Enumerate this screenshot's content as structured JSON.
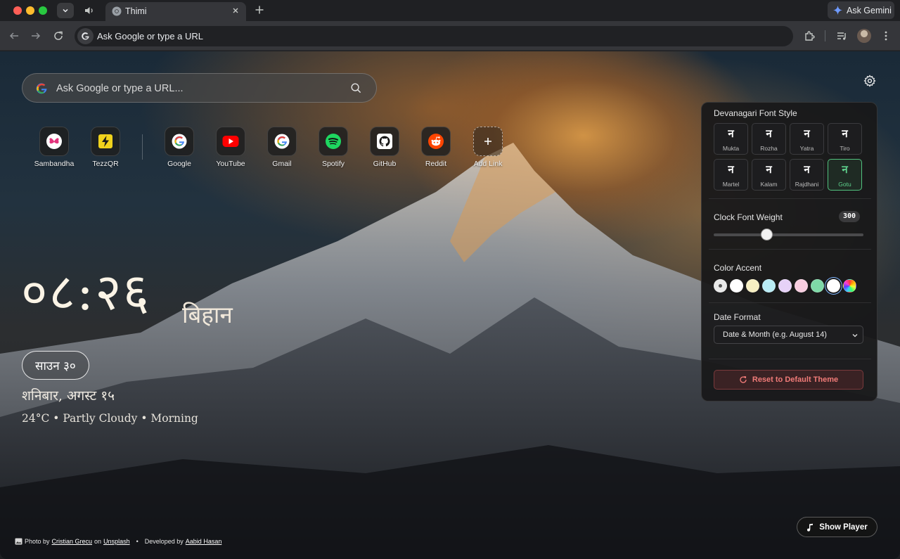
{
  "browser": {
    "tab_title": "Thimi",
    "ask_gemini": "Ask Gemini",
    "omnibox_placeholder": "Ask Google or type a URL"
  },
  "ntp": {
    "search_placeholder": "Ask Google or type a URL...",
    "shortcuts": [
      {
        "label": "Sambandha",
        "icon": "butterfly-icon"
      },
      {
        "label": "TezzQR",
        "icon": "lightning-icon"
      },
      {
        "label": "Google",
        "icon": "google-icon"
      },
      {
        "label": "YouTube",
        "icon": "youtube-icon"
      },
      {
        "label": "Gmail",
        "icon": "gmail-icon"
      },
      {
        "label": "Spotify",
        "icon": "spotify-icon"
      },
      {
        "label": "GitHub",
        "icon": "github-icon"
      },
      {
        "label": "Reddit",
        "icon": "reddit-icon"
      },
      {
        "label": "Add Link",
        "icon": "plus-icon"
      }
    ]
  },
  "clock": {
    "time": "०८:२६",
    "period": "बिहान",
    "nepali_date": "साउन ३०",
    "date_line": "शनिबार, अगस्ट १५",
    "weather": "24°C • Partly Cloudy • Morning"
  },
  "settings": {
    "font_style_heading": "Devanagari Font Style",
    "font_glyph": "न",
    "fonts": [
      {
        "name": "Mukta",
        "active": false
      },
      {
        "name": "Rozha",
        "active": false
      },
      {
        "name": "Yatra",
        "active": false
      },
      {
        "name": "Tiro",
        "active": false
      },
      {
        "name": "Martel",
        "active": false
      },
      {
        "name": "Kalam",
        "active": false
      },
      {
        "name": "Rajdhani",
        "active": false
      },
      {
        "name": "Gotu",
        "active": true
      }
    ],
    "clock_weight_heading": "Clock Font Weight",
    "clock_weight_value": "300",
    "clock_weight_min": 100,
    "clock_weight_max": 900,
    "color_accent_heading": "Color Accent",
    "accent_colors": [
      "#e9e9e9",
      "#ffffff",
      "#f7efc2",
      "#b9ecf5",
      "#e6d2f7",
      "#f8cde0",
      "#7ed9a7",
      "#ffffff"
    ],
    "accent_selected_index": 7,
    "date_format_heading": "Date Format",
    "date_format_value": "Date & Month (e.g. August 14)",
    "reset_label": "Reset to Default Theme"
  },
  "player": {
    "show_label": "Show Player"
  },
  "credits": {
    "photo_by": "Photo by",
    "photographer": "Cristian Grecu",
    "on": "on",
    "source": "Unsplash",
    "developed_by": "Developed by",
    "developer": "Aabid Hasan"
  }
}
